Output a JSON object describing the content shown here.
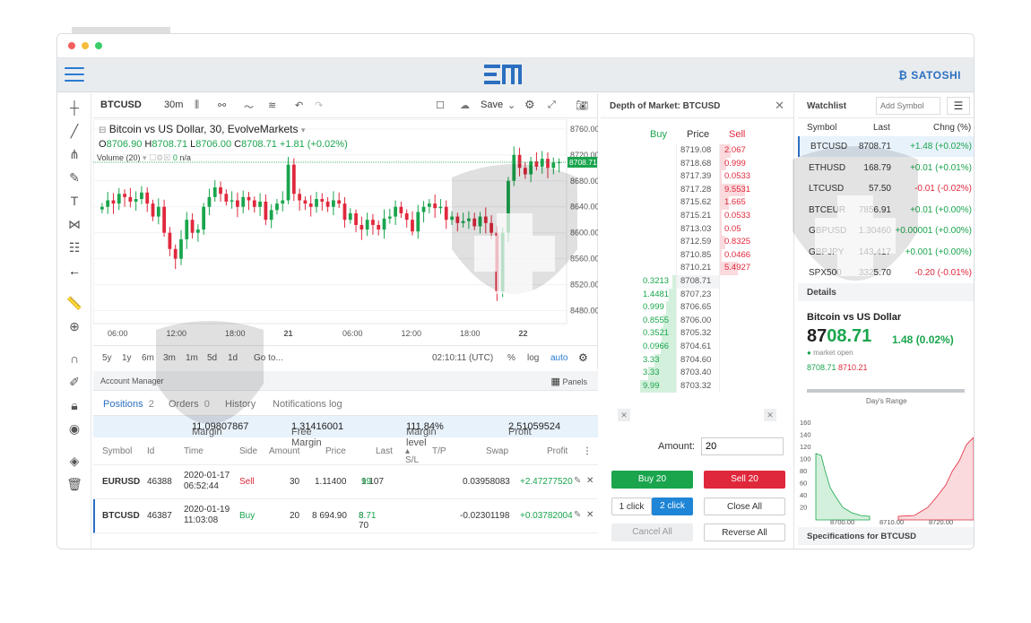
{
  "window_dots": [
    "#f25e5e",
    "#f5bd3c",
    "#3ccd6a"
  ],
  "brand": {
    "name": "SATOSHI"
  },
  "chart_toolbar": {
    "symbol": "BTCUSD",
    "interval": "30m",
    "save_label": "Save"
  },
  "chart": {
    "legend_title": "Bitcoin vs US Dollar, 30, EvolveMarkets",
    "o_label": "O",
    "o_value": "8706.90",
    "h_label": "H",
    "h_value": "8708.71",
    "l_label": "L",
    "l_value": "8706.00",
    "c_label": "C",
    "c_value": "8708.71",
    "change": "+1.81 (+0.02%)",
    "volume_label": "Volume (20)",
    "volume_value": "0",
    "volume_na": "n/a",
    "current_price": "8708.71"
  },
  "chart_data": {
    "type": "candlestick",
    "y_ticks": [
      "8760.00",
      "8720.00",
      "8680.00",
      "8640.00",
      "8600.00",
      "8560.00",
      "8520.00",
      "8480.00"
    ],
    "y_tick_values": [
      8760,
      8720,
      8680,
      8640,
      8600,
      8560,
      8520,
      8480
    ],
    "ylim": [
      8460,
      8775
    ],
    "x_ticks": [
      "06:00",
      "12:00",
      "18:00",
      "21",
      "06:00",
      "12:00",
      "18:00",
      "22"
    ],
    "closes": [
      8640,
      8650,
      8645,
      8660,
      8655,
      8648,
      8652,
      8662,
      8645,
      8625,
      8640,
      8600,
      8575,
      8560,
      8590,
      8620,
      8600,
      8605,
      8640,
      8655,
      8670,
      8660,
      8648,
      8650,
      8640,
      8655,
      8650,
      8640,
      8648,
      8620,
      8635,
      8645,
      8650,
      8705,
      8660,
      8650,
      8645,
      8640,
      8652,
      8648,
      8640,
      8650,
      8645,
      8620,
      8630,
      8612,
      8605,
      8620,
      8612,
      8605,
      8622,
      8625,
      8640,
      8630,
      8620,
      8602,
      8632,
      8640,
      8645,
      8638,
      8640,
      8620,
      8625,
      8615,
      8618,
      8622,
      8610,
      8625,
      8615,
      8600,
      8510,
      8600,
      8680,
      8720,
      8700,
      8690,
      8710,
      8702,
      8714,
      8700,
      8708,
      8708.71
    ]
  },
  "chart_footer": {
    "ranges": [
      "5y",
      "1y",
      "6m",
      "3m",
      "1m",
      "5d",
      "1d"
    ],
    "goto": "Go to...",
    "time": "02:10:11 (UTC)",
    "percent": "%",
    "log": "log",
    "auto": "auto"
  },
  "account": {
    "title": "Account Manager",
    "panels": "Panels",
    "tabs": [
      {
        "label": "Positions",
        "count": "2"
      },
      {
        "label": "Orders",
        "count": "0"
      },
      {
        "label": "History",
        "count": ""
      },
      {
        "label": "Notifications log",
        "count": ""
      }
    ],
    "summary": {
      "margin_label": "Margin",
      "margin": "11.09807867",
      "free_margin_label": "Free Margin",
      "free_margin": "1.31416001",
      "margin_level_label": "Margin level",
      "margin_level": "111.84%",
      "profit_label": "Profit",
      "profit": "2.51059524"
    },
    "columns": [
      "Symbol",
      "Id",
      "Time",
      "Side",
      "Amount",
      "Price",
      "Last",
      "S/L",
      "T/P",
      "Swap",
      "Profit"
    ],
    "rows": [
      {
        "symbol": "EURUSD",
        "id": "46388",
        "date": "2020-01-17",
        "time": "06:52:44",
        "side": "Sell",
        "amount": "30",
        "price": "1.11400",
        "last_a": "1.107",
        "last_b": "99",
        "swap": "0.03958083",
        "profit": "+2.47277520"
      },
      {
        "symbol": "BTCUSD",
        "id": "46387",
        "date": "2020-01-19",
        "time": "11:03:08",
        "side": "Buy",
        "amount": "20",
        "price": "8 694.90",
        "last_a": "8 70",
        "last_b": "8.71",
        "swap": "-0.02301198",
        "profit": "+0.03782004"
      }
    ]
  },
  "dom": {
    "title": "Depth of Market: BTCUSD",
    "buy_label": "Buy",
    "price_label": "Price",
    "sell_label": "Sell",
    "sells": [
      {
        "price": "8719.08",
        "size": "2.067",
        "depth": 0.3
      },
      {
        "price": "8718.68",
        "size": "0.999",
        "depth": 0.18
      },
      {
        "price": "8717.39",
        "size": "0.0533",
        "depth": 0.05
      },
      {
        "price": "8717.28",
        "size": "9.5531",
        "depth": 0.7
      },
      {
        "price": "8715.62",
        "size": "1.665",
        "depth": 0.25
      },
      {
        "price": "8715.21",
        "size": "0.0533",
        "depth": 0.05
      },
      {
        "price": "8713.03",
        "size": "0.05",
        "depth": 0.05
      },
      {
        "price": "8712.59",
        "size": "0.8325",
        "depth": 0.15
      },
      {
        "price": "8710.85",
        "size": "0.0466",
        "depth": 0.05
      },
      {
        "price": "8710.21",
        "size": "5.4927",
        "depth": 0.5
      }
    ],
    "buys": [
      {
        "price": "8708.71",
        "size": "0.3213",
        "depth": 0.1
      },
      {
        "price": "8707.23",
        "size": "1.4481",
        "depth": 0.2
      },
      {
        "price": "8706.65",
        "size": "0.999",
        "depth": 0.28
      },
      {
        "price": "8706.00",
        "size": "0.8555",
        "depth": 0.35
      },
      {
        "price": "8705.32",
        "size": "0.3521",
        "depth": 0.4
      },
      {
        "price": "8704.61",
        "size": "0.0966",
        "depth": 0.42
      },
      {
        "price": "8704.60",
        "size": "3.33",
        "depth": 0.6
      },
      {
        "price": "8703.40",
        "size": "3.33",
        "depth": 0.78
      },
      {
        "price": "8703.32",
        "size": "9.99",
        "depth": 1.0
      }
    ],
    "amount_label": "Amount:",
    "amount_value": "20",
    "buy_button": "Buy 20",
    "sell_button": "Sell 20",
    "one_click": "1 click",
    "two_click": "2 click",
    "close_all": "Close All",
    "cancel_all": "Cancel All",
    "reverse_all": "Reverse All"
  },
  "watchlist": {
    "title": "Watchlist",
    "add_placeholder": "Add Symbol",
    "col_symbol": "Symbol",
    "col_last": "Last",
    "col_change": "Chng (%)",
    "items": [
      {
        "symbol": "BTCUSD",
        "last": "8708.71",
        "change": "+1.48 (+0.02%)",
        "dir": "pos"
      },
      {
        "symbol": "ETHUSD",
        "last": "168.79",
        "change": "+0.01 (+0.01%)",
        "dir": "pos"
      },
      {
        "symbol": "LTCUSD",
        "last": "57.50",
        "change": "-0.01 (-0.02%)",
        "dir": "neg"
      },
      {
        "symbol": "BTCEUR",
        "last": "7856.91",
        "change": "+0.01 (+0.00%)",
        "dir": "pos"
      },
      {
        "symbol": "GBPUSD",
        "last": "1.30460",
        "change": "+0.00001 (+0.00%)",
        "dir": "pos"
      },
      {
        "symbol": "GBPJPY",
        "last": "143.417",
        "change": "+0.001 (+0.00%)",
        "dir": "pos"
      },
      {
        "symbol": "SPX500",
        "last": "3325.70",
        "change": "-0.20 (-0.01%)",
        "dir": "neg"
      }
    ],
    "details_title": "Details",
    "details_name": "Bitcoin vs US Dollar",
    "details_price_a": "87",
    "details_price_b": "08.71",
    "details_change": "1.48 (0.02%)",
    "market_status": "market open",
    "bid": "8708.71",
    "ask": "8710.21",
    "days_range": "Day's Range",
    "depth_y_ticks": [
      "160",
      "140",
      "120",
      "100",
      "80",
      "60",
      "40",
      "20"
    ],
    "depth_x_ticks": [
      "8700.00",
      "8710.00",
      "8720.00"
    ],
    "specs_title": "Specifications for BTCUSD"
  }
}
